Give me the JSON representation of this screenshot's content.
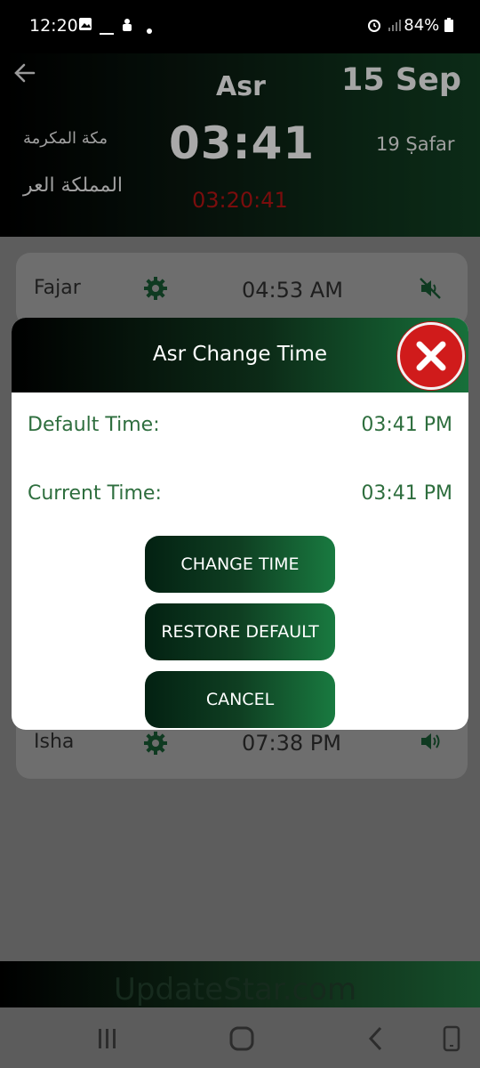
{
  "status": {
    "time": "12:20",
    "battery": "84%"
  },
  "header": {
    "prayer_name": "Asr",
    "date": "15 Sep",
    "city": "مكة المكرمة",
    "country": "المملكة العر",
    "time": "03:41",
    "hijri": "19 Ṣafar",
    "countdown": "03:20:41"
  },
  "prayers": [
    {
      "name": "Fajar",
      "time": "04:53 AM",
      "sound": "muted"
    },
    {
      "name": "Isha",
      "time": "07:38 PM",
      "sound": "on"
    }
  ],
  "dialog": {
    "title": "Asr Change Time",
    "default_label": "Default Time:",
    "default_value": "03:41 PM",
    "current_label": "Current Time:",
    "current_value": "03:41 PM",
    "buttons": {
      "change": "CHANGE TIME",
      "restore": "RESTORE DEFAULT",
      "cancel": "CANCEL"
    }
  },
  "ad_text": "UpdateStar.com",
  "colors": {
    "accent_green": "#2e6e3e",
    "close_red": "#d01b1b",
    "countdown_red": "#7a0d0d"
  }
}
